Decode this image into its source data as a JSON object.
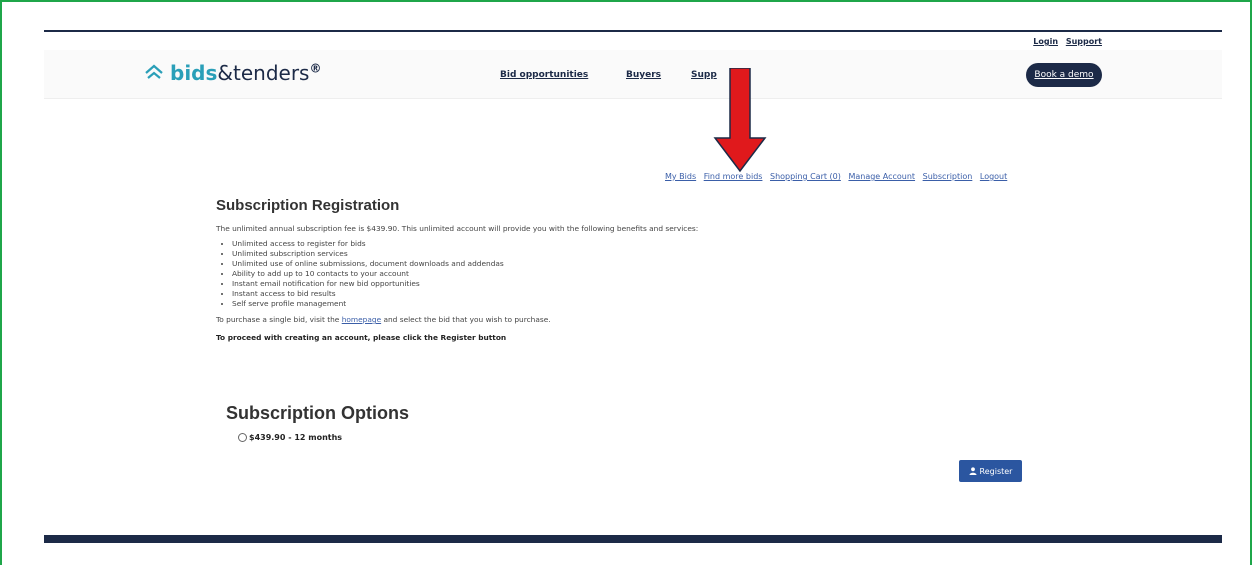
{
  "utility": {
    "login": "Login",
    "support": "Support"
  },
  "logo": {
    "bids": "bids",
    "rest": "&tenders",
    "reg": "®"
  },
  "nav": {
    "bid_opportunities": "Bid opportunities",
    "buyers": "Buyers",
    "support_partial": "Supp"
  },
  "header": {
    "demo_button": "Book a demo"
  },
  "account_links": [
    "My Bids",
    "Find more bids",
    "Shopping Cart (0)",
    "Manage Account",
    "Subscription",
    "Logout"
  ],
  "page": {
    "title": "Subscription Registration",
    "intro": "The unlimited annual subscription fee is $439.90. This unlimited account will provide you with the following benefits and services:",
    "benefits": [
      "Unlimited access to register for bids",
      "Unlimited subscription services",
      "Unlimited use of online submissions, document downloads and addendas",
      "Ability to add up to 10 contacts to your account",
      "Instant email notification for new bid opportunities",
      "Instant access to bid results",
      "Self serve profile management"
    ],
    "purchase_prefix": "To purchase a single bid, visit the ",
    "purchase_link": "homepage",
    "purchase_suffix": " and select the bid that you wish to purchase.",
    "proceed": "To proceed with creating an account, please click the Register button"
  },
  "options": {
    "title": "Subscription Options",
    "items": [
      "$439.90 - 12 months"
    ]
  },
  "register_button": "Register",
  "colors": {
    "accent_navy": "#1c2a47",
    "link_blue": "#3a5ea8",
    "button_blue": "#2b56a0",
    "arrow_red": "#e0191c",
    "frame_green": "#1fa64a",
    "logo_teal": "#2a9fb8"
  },
  "icons": {
    "logo": "chevron-up-double-icon",
    "register": "user-icon",
    "annotation": "red-down-arrow"
  }
}
